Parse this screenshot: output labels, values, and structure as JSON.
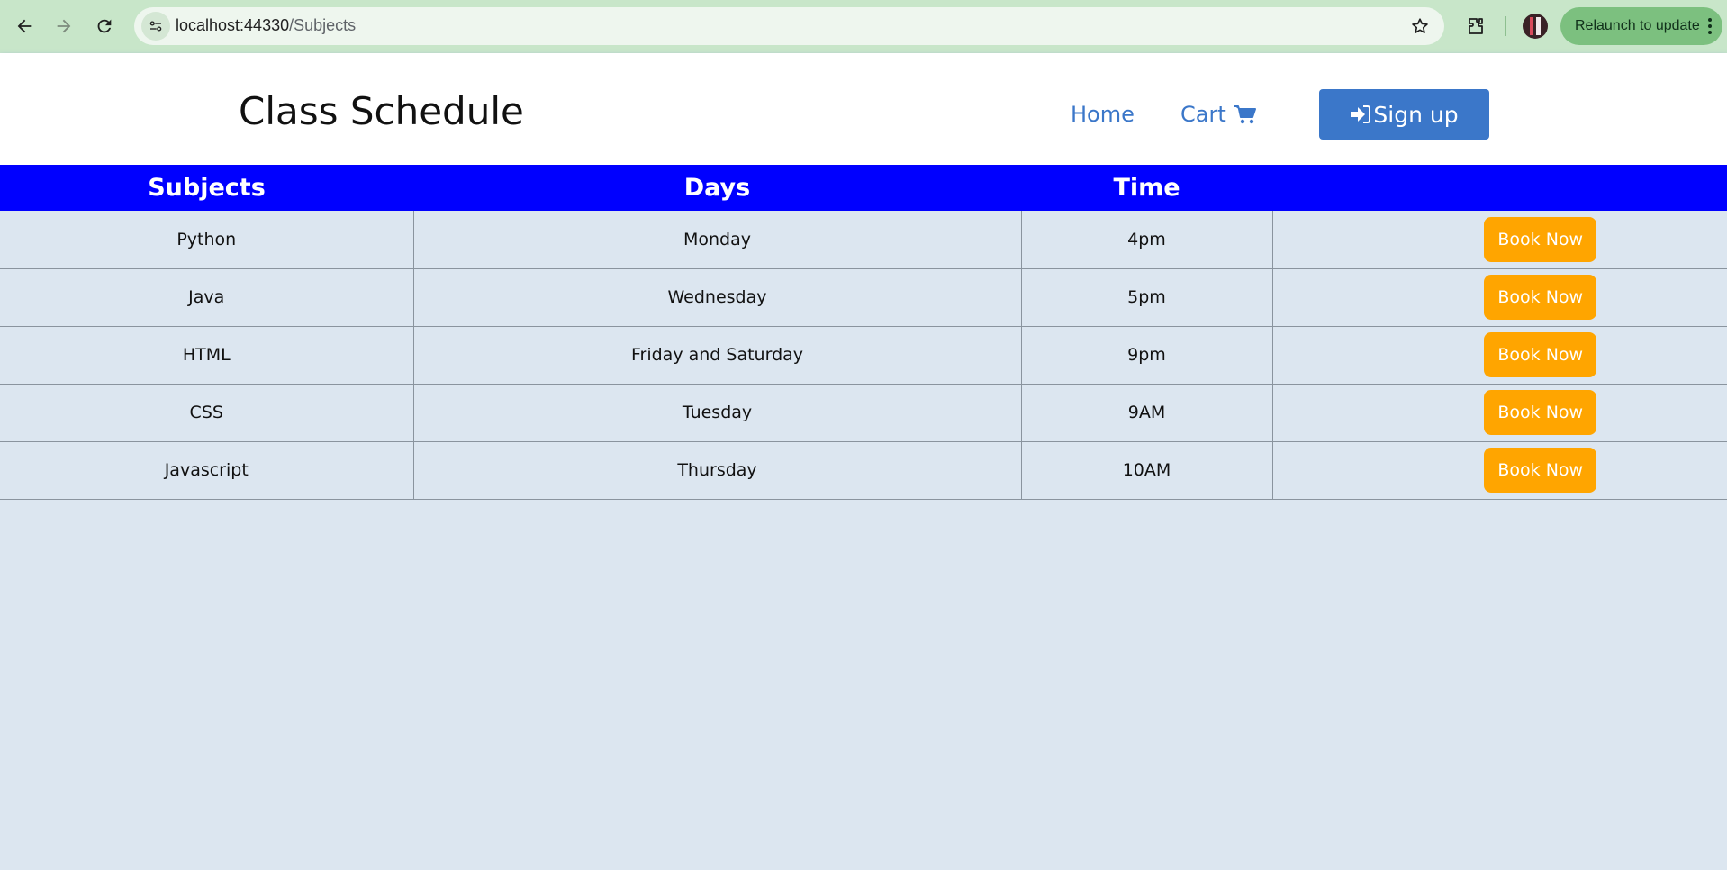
{
  "browser": {
    "url_host": "localhost:44330",
    "url_path": "/Subjects",
    "relaunch_label": "Relaunch to update"
  },
  "header": {
    "brand": "Class Schedule",
    "nav": {
      "home": "Home",
      "cart": "Cart",
      "signup": "Sign up"
    }
  },
  "table": {
    "headers": [
      "Subjects",
      "Days",
      "Time",
      ""
    ],
    "rows": [
      {
        "subject": "Python",
        "day": "Monday",
        "time": "4pm",
        "action": "Book Now"
      },
      {
        "subject": "Java",
        "day": "Wednesday",
        "time": "5pm",
        "action": "Book Now"
      },
      {
        "subject": "HTML",
        "day": "Friday and Saturday",
        "time": "9pm",
        "action": "Book Now"
      },
      {
        "subject": "CSS",
        "day": "Tuesday",
        "time": "9AM",
        "action": "Book Now"
      },
      {
        "subject": "Javascript",
        "day": "Thursday",
        "time": "10AM",
        "action": "Book Now"
      }
    ]
  },
  "colors": {
    "header_blue": "#0000ff",
    "link_blue": "#3b77c9",
    "book_orange": "#ffa500",
    "page_bg": "#dce6f0"
  },
  "icons": [
    "back-arrow-icon",
    "forward-arrow-icon",
    "reload-icon",
    "site-info-icon",
    "bookmark-star-icon",
    "extensions-icon",
    "profile-avatar",
    "more-vert-icon",
    "cart-icon",
    "sign-in-icon"
  ]
}
